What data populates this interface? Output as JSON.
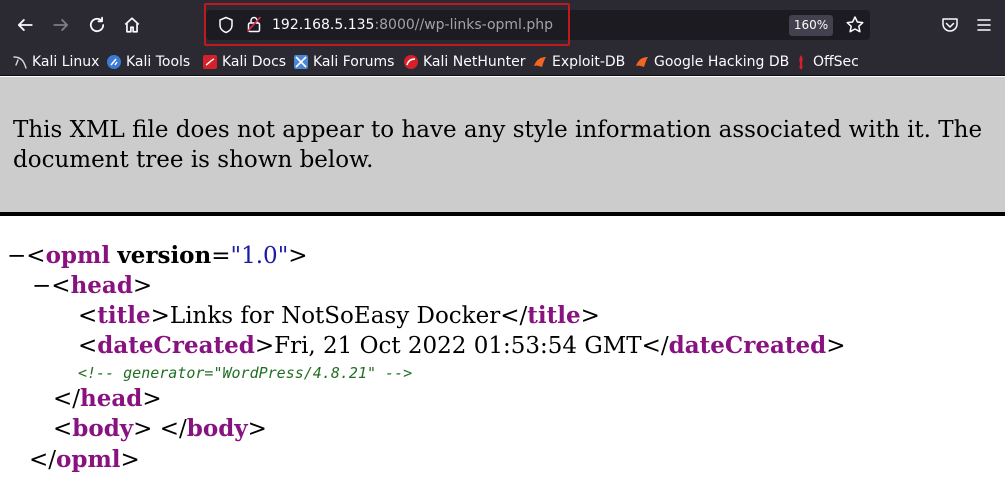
{
  "browser": {
    "url_host": "192.168.5.135",
    "url_rest": ":8000//wp-links-opml.php",
    "zoom": "160%",
    "icons": {
      "back": "back-arrow-icon",
      "forward": "forward-arrow-icon",
      "reload": "reload-icon",
      "home": "home-icon",
      "shield": "tracking-shield-icon",
      "lock": "insecure-lock-icon",
      "star": "bookmark-star-icon",
      "pocket": "pocket-icon",
      "menu": "hamburger-menu-icon"
    },
    "bookmarks": [
      {
        "label": "Kali Linux",
        "icon": "kali-dragon-icon",
        "color": "#d8d8d8"
      },
      {
        "label": "Kali Tools",
        "icon": "kali-tools-icon",
        "color": "#3b7bd6"
      },
      {
        "label": "Kali Docs",
        "icon": "kali-docs-icon",
        "color": "#d6202a"
      },
      {
        "label": "Kali Forums",
        "icon": "kali-forums-icon",
        "color": "#4a86d8"
      },
      {
        "label": "Kali NetHunter",
        "icon": "nethunter-icon",
        "color": "#d6202a"
      },
      {
        "label": "Exploit-DB",
        "icon": "exploit-db-icon",
        "color": "#f26522"
      },
      {
        "label": "Google Hacking DB",
        "icon": "ghdb-icon",
        "color": "#f26522"
      },
      {
        "label": "OffSec",
        "icon": "offsec-icon",
        "color": "#d6202a"
      }
    ]
  },
  "page": {
    "info_message": "This XML file does not appear to have any style information associated with it. The document tree is shown below.",
    "xml": {
      "collapse_glyph": "−",
      "opml_tag": "opml",
      "version_attr": "version",
      "version_value": "\"1.0\"",
      "head_tag": "head",
      "title_tag": "title",
      "title_text": "Links for NotSoEasy Docker",
      "dateCreated_tag": "dateCreated",
      "dateCreated_text": "Fri, 21 Oct 2022 01:53:54 GMT",
      "comment": "<!-- generator=\"WordPress/4.8.21\" -->",
      "body_tag": "body"
    }
  }
}
